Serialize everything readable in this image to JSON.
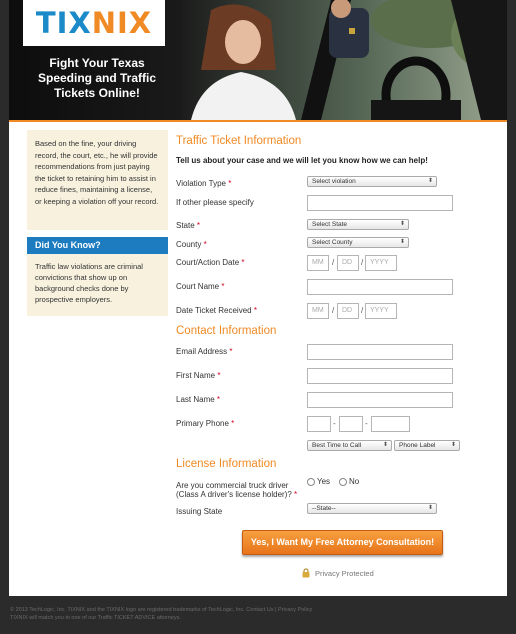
{
  "header": {
    "logo_part1": "TIX",
    "logo_part2": "NIX",
    "tagline": "Fight Your Texas Speeding and Traffic Tickets Online!"
  },
  "sidebar": {
    "intro": "Based on the fine, your driving record, the court, etc., he will provide recommendations from just paying the ticket to retaining him to assist in reduce fines, maintaining a license, or keeping a violation off your record.",
    "did_you_know_title": "Did You Know?",
    "did_you_know_text": "Traffic law violations are criminal convictions that show up on background checks done by prospective employers."
  },
  "form": {
    "traffic_title": "Traffic Ticket Information",
    "intro": "Tell us about your case and we will let you know how we can help!",
    "violation_type_label": "Violation Type",
    "violation_type_value": "Select violation",
    "other_label": "If other please specify",
    "state_label": "State",
    "state_value": "Select State",
    "county_label": "County",
    "county_value": "Select County",
    "court_date_label": "Court/Action Date",
    "date_mm": "MM",
    "date_dd": "DD",
    "date_yyyy": "YYYY",
    "court_name_label": "Court Name",
    "ticket_date_label": "Date Ticket Received",
    "contact_title": "Contact Information",
    "email_label": "Email Address",
    "first_name_label": "First Name",
    "last_name_label": "Last Name",
    "phone_label": "Primary Phone",
    "best_time_value": "Best Time to Call",
    "phone_type_value": "Phone Label",
    "license_title": "License Information",
    "truck_driver_label": "Are you commercial truck driver (Class A driver's license holder)?",
    "yes_label": "Yes",
    "no_label": "No",
    "issuing_state_label": "Issuing State",
    "issuing_state_value": "--State--",
    "submit_label": "Yes, I Want My Free Attorney Consultation!",
    "privacy_label": "Privacy Protected"
  },
  "footer": {
    "line1": "© 2013 TechLogic, Inc. TIXNIX and the TIXNIX logo are registered trademarks of TechLogic, Inc. Contact Us | Privacy Policy",
    "line2": "TIXNIX will match you to one of our Traffic TICKET ADVICE attorneys."
  },
  "colors": {
    "accent_orange": "#f08a24",
    "accent_blue": "#1d7cc0",
    "required_red": "#d0021b"
  }
}
